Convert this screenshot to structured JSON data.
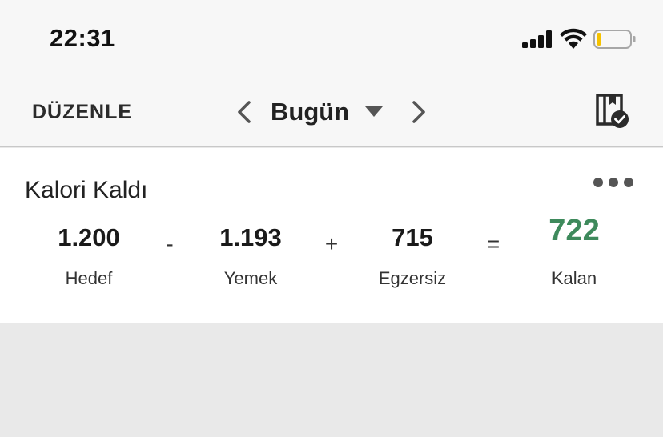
{
  "status_bar": {
    "time": "22:31",
    "icons": [
      "cellular-signal-icon",
      "wifi-icon",
      "battery-low-icon"
    ],
    "battery_level": 0.15
  },
  "nav": {
    "edit_label": "DÜZENLE",
    "date_label": "Bugün",
    "icons": [
      "chevron-left-icon",
      "caret-down-icon",
      "chevron-right-icon",
      "complete-diary-icon"
    ]
  },
  "calories": {
    "title": "Kalori Kaldı",
    "goal_value": "1.200",
    "goal_label": "Hedef",
    "op_minus": "-",
    "food_value": "1.193",
    "food_label": "Yemek",
    "op_plus": "+",
    "exercise_value": "715",
    "exercise_label": "Egzersiz",
    "op_equals": "=",
    "remaining_value": "722",
    "remaining_label": "Kalan",
    "remaining_color": "#3e8a5c"
  }
}
